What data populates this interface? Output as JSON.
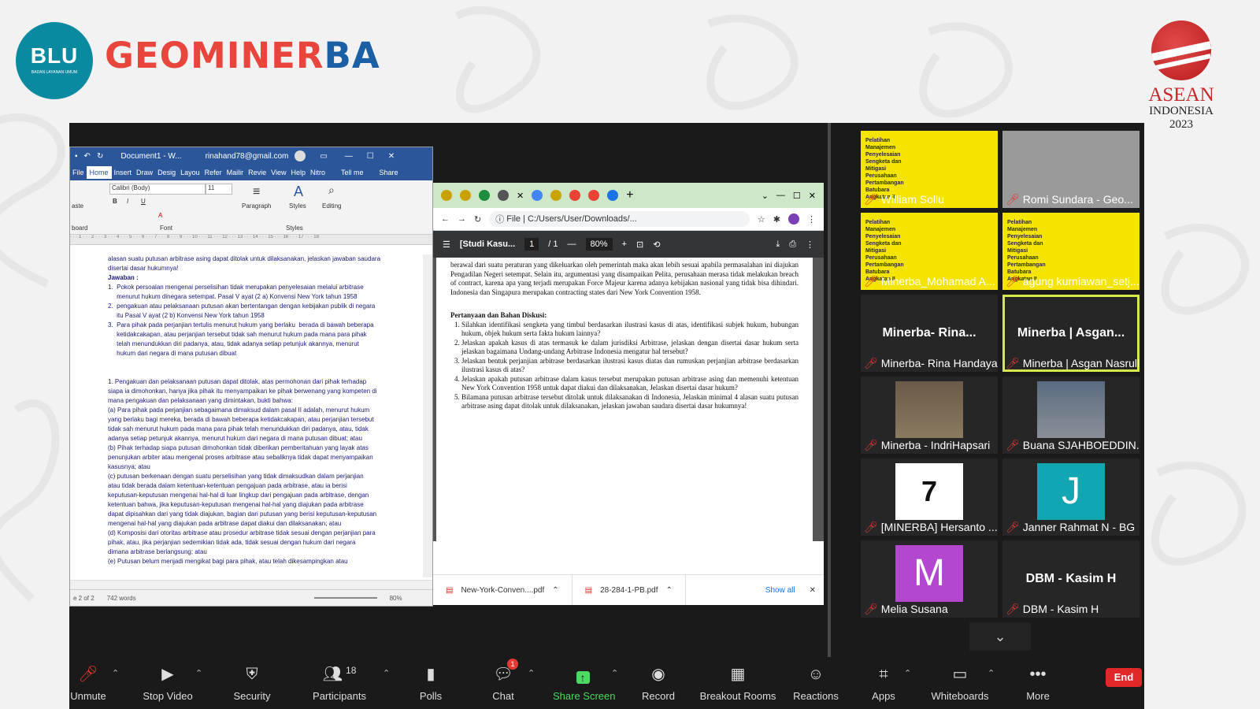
{
  "brand": {
    "blu_main": "BLU",
    "blu_sub": "BADAN LAYANAN UMUM",
    "geo_part1": "GEO",
    "geo_part2": "MINER",
    "geo_part3": "BA",
    "asean_line1": "ASEAN",
    "asean_line2": "INDONESIA",
    "asean_line3": "2023"
  },
  "word": {
    "title": "Document1 - W...",
    "user": "rinahand78@gmail.com",
    "tabs": [
      "File",
      "Home",
      "Insert",
      "Draw",
      "Desig",
      "Layou",
      "Refer",
      "Mailir",
      "Revie",
      "View",
      "Help",
      "Nitro",
      "Tell me",
      "Share"
    ],
    "font": "Calibri (Body)",
    "size": "11",
    "group_font": "Font",
    "group_paragraph": "Paragraph",
    "group_styles": "Styles",
    "group_editing": "Editing",
    "group_clipboard": "board",
    "paste": "aste",
    "lines": [
      "alasan suatu putusan arbitrase asing dapat ditolak untuk dilaksanakan, jelaskan jawaban saudara",
      "disertai dasar hukumnya!",
      "Jawaban :",
      "1.  Pokok persoalan mengenai perselisihan tidak merupakan penyelesaian melalui arbitrase",
      "     menurut hukum dinegara setempat. Pasal V ayat (2 a) Konvensi New York tahun 1958",
      "2.  pengakuan atau pelaksanaan putusan akan bertentangan dengan kebijakan publik di negara",
      "     itu Pasal V ayat (2 b) Konvensi New York tahun 1958",
      "3.  Para pihak pada perjanjian tertulis menurut hukum yang berlaku  berada di bawah beberapa",
      "     ketidakcakapan, atau perjanjian tersebut tidak sah menurut hukum pada mana para pihak",
      "     telah menundukkan diri padanya, atau, tidak adanya setiap petunjuk akannya, menurut",
      "     hukum dari negara di mana putusan dibuat",
      "",
      "",
      "1. Pengakuan dan pelaksanaan putusan dapat ditolak, atas permohonan dari pihak terhadap",
      "siapa ia dimohonkan, hanya jika pihak itu menyampaikan ke pihak berwenang yang kompeten di",
      "mana pengakuan dan pelaksanaan yang dimintakan, bukti bahwa:",
      "(a) Para pihak pada perjanjian sebagaimana dimaksud dalam pasal II adalah, menurut hukum",
      "yang berlaku bagi mereka, berada di bawah beberapa ketidakcakapan, atau perjanjian tersebut",
      "tidak sah menurut hukum pada mana para pihak telah menundukkan diri padanya, atau, tidak",
      "adanya setiap petunjuk akannya, menurut hukum dari negara di mana putusan dibuat; atau",
      "(b) Pihak terhadap siapa putusan dimohonkan tidak diberikan pemberitahuan yang layak atas",
      "penunjukan arbiter atau mengenai proses arbitrase atau sebaliknya tidak dapat menyampaikan",
      "kasusnya; atau",
      "(c) putusan berkenaan dengan suatu perselisihan yang tidak dimaksudkan dalam perjanjian",
      "atau tidak berada dalam ketentuan-ketentuan pengajuan pada arbitrase, atau ia berisi",
      "keputusan-keputusan mengenai hal-hal di luar lingkup dari pengajuan pada arbitrase, dengan",
      "ketentuan bahwa, jika keputusan-keputusan mengenai hal-hal yang diajukan pada arbitrase",
      "dapat dipisahkan dari yang tidak diajukan, bagian dari putusan yang berisi keputusan-keputusan",
      "mengenai hal-hal yang diajukan pada arbitrase dapat diakui dan dilaksanakan; atau",
      "(d) Komposisi dari otoritas arbitrase atau prosedur arbitrase tidak sesuai dengan perjanjian para",
      "pihak, atau, jika perjanjian sedemikian tidak ada, tidak sesuai dengan hukum dari negara",
      "dimana arbitrase berlangsung; atau",
      "(e) Putusan belum menjadi mengikat bagi para pihak, atau telah dikesampingkan atau"
    ],
    "status_page": "e 2 of 2",
    "status_words": "742 words",
    "zoom": "80%"
  },
  "chrome": {
    "url": "C:/Users/User/Downloads/...",
    "file_label": "File",
    "pdf_title": "[Studi Kasu...",
    "page_current": "1",
    "page_total": "/ 1",
    "zoom": "80%",
    "pdf_intro": "berawal dari suatu peraturan yang dikeluarkan oleh pemerintah maka akan lebih sesuai apabila permasalahan ini diajukan Pengadilan Negeri setempat. Selain itu, argumentasi yang disampaikan Pelita, perusahaan merasa tidak melakukan breach of contract, karena apa yang terjadi merupakan Force Majeur karena adanya kebijakan nasional yang tidak bisa dihindari. Indonesia dan Singapura merupakan contracting states dari New York Convention 1958.",
    "pdf_heading": "Pertanyaan dan Bahan Diskusi:",
    "pdf_items": [
      "Silahkan identifikasi sengketa yang timbul berdasarkan ilustrasi kasus di atas, identifikasi subjek hukum, hubungan hukum, objek hukum serta fakta hukum lainnya?",
      "Jelaskan apakah kasus di atas termasuk ke dalam jurisdiksi Arbitrase, jelaskan dengan disertai dasar hukum serta jelaskan bagaimana Undang-undang Arbitrase Indonesia mengatur hal tersebut?",
      "Jelaskan bentuk perjanjian arbitrase berdasarkan ilustrasi kasus diatas dan rumuskan perjanjian arbitrase berdasarkan ilustrasi kasus di atas?",
      "Jelaskan apakah putusan arbitrase dalam kasus tersebut merupakan putusan arbitrase asing dan memenuhi ketentuan New York Convention 1958 untuk dapat diakui dan dilaksanakan, Jelaskan disertai dasar hukum?",
      "Bilamana putusan arbitrase tersebut ditolak untuk dilaksanakan di Indonesia, Jelaskan minimal 4 alasan suatu putusan arbitrase asing dapat ditolak untuk dilaksanakan, jelaskan jawaban saudara disertai dasar hukumnya!"
    ],
    "downloads": [
      "New-York-Conven....pdf",
      "28-284-1-PB.pdf"
    ],
    "show_all": "Show all"
  },
  "participants": [
    {
      "name": "William Sollu",
      "type": "yellow"
    },
    {
      "name": "Romi Sundara - Geo...",
      "type": "gray"
    },
    {
      "name": "Minerba_Mohamad A...",
      "type": "yellow"
    },
    {
      "name": "agung kurniawan_setj...",
      "type": "yellow"
    },
    {
      "name": "Minerba- Rina Handayani",
      "big": "Minerba- Rina...",
      "type": "dark"
    },
    {
      "name": "Minerba | Asgan Nasrull...",
      "big": "Minerba | Asgan...",
      "type": "dark-hl"
    },
    {
      "name": "Minerba - IndriHapsari",
      "type": "photo1"
    },
    {
      "name": "Buana SJAHBOEDDIN...",
      "type": "photo2"
    },
    {
      "name": "[MINERBA] Hersanto ...",
      "avatar": "7",
      "type": "white"
    },
    {
      "name": "Janner Rahmat N - BG",
      "avatar": "J",
      "type": "teal"
    },
    {
      "name": "Melia Susana",
      "avatar": "M",
      "type": "purple"
    },
    {
      "name": "DBM - Kasim H",
      "big": "DBM - Kasim H",
      "type": "dark"
    }
  ],
  "yellow_tile_text": "Pelatihan Manajemen Penyelesaian Sengketa dan Mitigasi Perusahaan Pertambangan Batubara Angkatan II",
  "toolbar": {
    "unmute": "Unmute",
    "stop_video": "Stop Video",
    "security": "Security",
    "participants": "Participants",
    "participants_count": "18",
    "polls": "Polls",
    "chat": "Chat",
    "chat_badge": "1",
    "share_screen": "Share Screen",
    "record": "Record",
    "breakout": "Breakout Rooms",
    "reactions": "Reactions",
    "apps": "Apps",
    "whiteboards": "Whiteboards",
    "more": "More",
    "end": "End"
  },
  "colors": {
    "word_blue": "#2b579a",
    "zoom_bg": "#1a1a1a",
    "share_green": "#4cd964",
    "end_red": "#e02828",
    "geo_red": "#e8453c",
    "blu_teal": "#0a8aa0"
  }
}
